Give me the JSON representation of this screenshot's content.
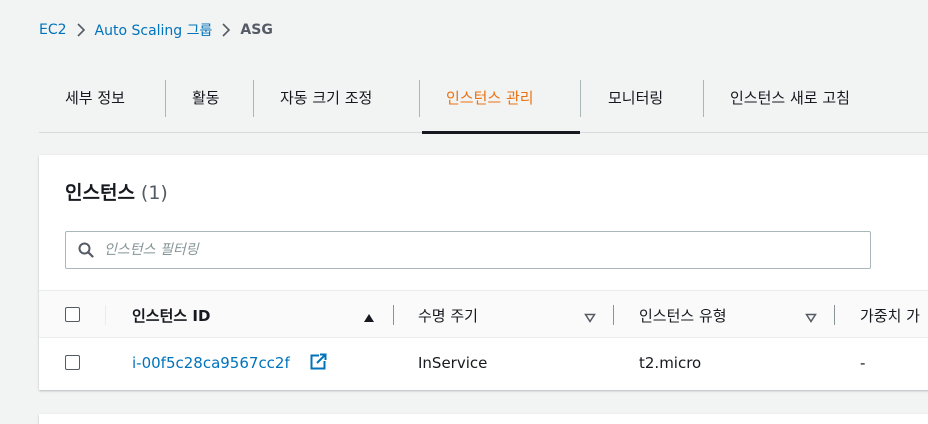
{
  "breadcrumb": {
    "items": [
      "EC2",
      "Auto Scaling 그룹"
    ],
    "current": "ASG"
  },
  "tabs": [
    {
      "label": "세부 정보",
      "active": false
    },
    {
      "label": "활동",
      "active": false
    },
    {
      "label": "자동 크기 조정",
      "active": false
    },
    {
      "label": "인스턴스 관리",
      "active": true
    },
    {
      "label": "모니터링",
      "active": false
    },
    {
      "label": "인스턴스 새로 고침",
      "active": false
    }
  ],
  "panel": {
    "title": "인스턴스",
    "count": "(1)"
  },
  "filter": {
    "placeholder": "인스턴스 필터링",
    "value": ""
  },
  "table": {
    "columns": [
      "인스턴스 ID",
      "수명 주기",
      "인스턴스 유형",
      "가중치 가"
    ],
    "rows": [
      {
        "instance_id": "i-00f5c28ca9567cc2f",
        "lifecycle": "InService",
        "instance_type": "t2.micro",
        "weight": "-"
      }
    ]
  },
  "colors": {
    "link": "#0073bb",
    "active_tab": "#ec7211",
    "background": "#f2f3f3"
  },
  "icons": [
    "chevron-right-icon",
    "search-icon",
    "sort-ascending-icon",
    "sort-descending-icon",
    "external-link-icon"
  ]
}
